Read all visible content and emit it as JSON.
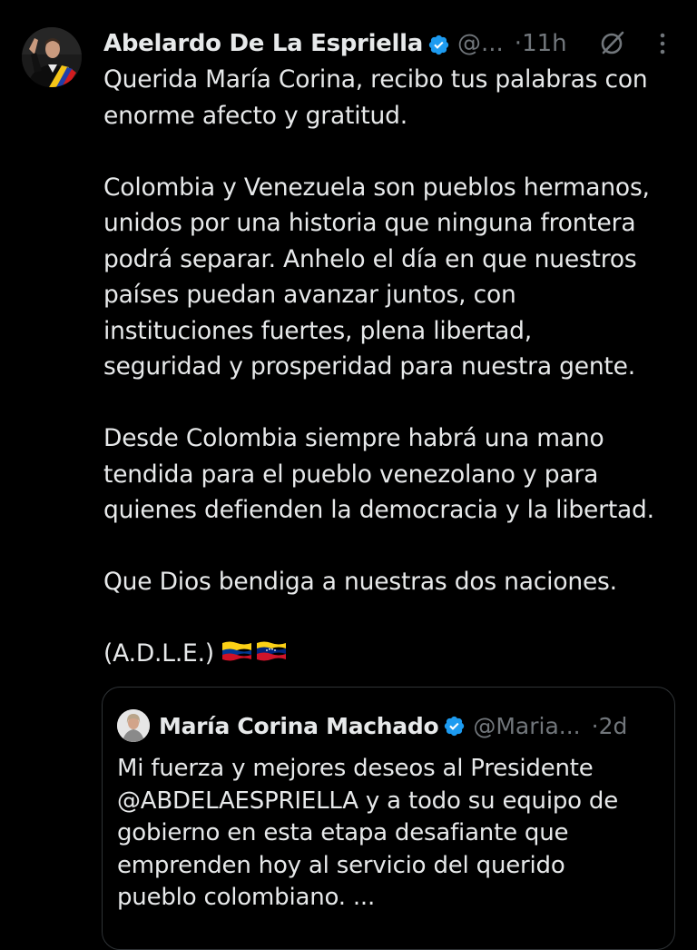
{
  "tweet": {
    "author": {
      "display_name": "Abelardo De La Espriella",
      "handle": "@...",
      "verified": true,
      "avatar_icon": "avatar-president-sash"
    },
    "separator": "·",
    "time": "11h",
    "icons": [
      "verified-badge-icon",
      "grok-icon",
      "more-icon"
    ],
    "paragraphs": [
      [
        "Querida María Corina, recibo tus palabras con",
        "enorme afecto y gratitud."
      ],
      [
        "Colombia y Venezuela son pueblos hermanos,",
        "unidos por una historia que ninguna frontera",
        "podrá separar. Anhelo el día en que nuestros",
        "países puedan avanzar juntos, con",
        "instituciones fuertes, plena libertad,",
        "seguridad y prosperidad para nuestra gente."
      ],
      [
        "Desde Colombia siempre habrá una mano",
        "tendida para el pueblo venezolano y para",
        "quienes defienden la democracia y la libertad."
      ],
      [
        "Que Dios bendiga a nuestras dos naciones."
      ]
    ],
    "signature": "(A.D.L.E.)",
    "flag_emojis": [
      "colombia-flag",
      "venezuela-flag"
    ]
  },
  "quoted_tweet": {
    "author": {
      "display_name": "María Corina Machado",
      "handle": "@Maria...",
      "verified": true
    },
    "separator": "·",
    "time": "2d",
    "lines": [
      "Mi fuerza y mejores deseos al Presidente",
      "@ABDELAESPRIELLA y a todo su equipo de",
      "gobierno en esta etapa desafiante que",
      "emprenden hoy al servicio del querido",
      "pueblo colombiano. ..."
    ]
  },
  "colors": {
    "background": "#000000",
    "text_primary": "#e7e9ea",
    "text_secondary": "#71767b",
    "verified_blue": "#1d9bf0",
    "quote_border": "#2f3336"
  }
}
